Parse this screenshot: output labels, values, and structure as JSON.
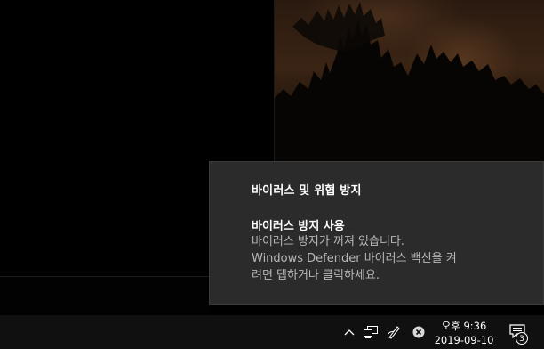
{
  "notification": {
    "header": "바이러스 및 위협 방지",
    "title": "바이러스 방지 사용",
    "body_lines": [
      "바이러스 방지가 꺼져 있습니다.",
      "Windows Defender 바이러스 백신을 켜",
      "려면 탭하거나 클릭하세요."
    ]
  },
  "taskbar": {
    "tray_icons": [
      "chevron-up-icon",
      "network-icon",
      "pen-icon",
      "defender-warning-icon"
    ],
    "clock": {
      "time": "오후 9:36",
      "date": "2019-09-10"
    },
    "action_center": {
      "icon": "notification-icon",
      "badge_count": "3"
    }
  },
  "colors": {
    "toast_bg": "#2b2b2b",
    "taskbar_bg": "#101010",
    "text_primary": "#ffffff",
    "text_secondary": "#b8b8b8"
  }
}
